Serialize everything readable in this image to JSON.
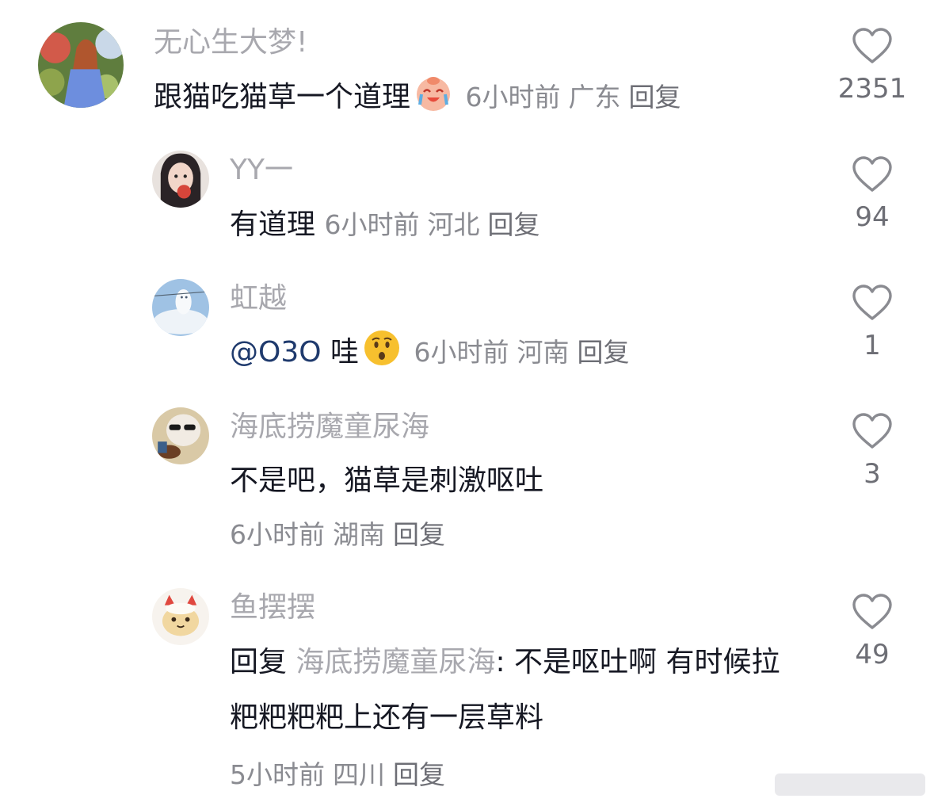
{
  "comments": [
    {
      "username": "无心生大梦!",
      "text": "跟猫吃猫草一个道理",
      "emoji": "crying-laughing-emoji",
      "time": "6小时前",
      "location": "广东",
      "reply": "回复",
      "likes": "2351"
    },
    {
      "username": "YY一",
      "text": "有道理",
      "time": "6小时前",
      "location": "河北",
      "reply": "回复",
      "likes": "94"
    },
    {
      "username": "虹越",
      "mention": "@O3O",
      "text": "哇",
      "emoji": "surprised-face-emoji",
      "time": "6小时前",
      "location": "河南",
      "reply": "回复",
      "likes": "1"
    },
    {
      "username": "海底捞魔童尿海",
      "text": "不是吧，猫草是刺激呕吐",
      "time": "6小时前",
      "location": "湖南",
      "reply": "回复",
      "likes": "3"
    },
    {
      "username": "鱼摆摆",
      "reply_prefix": "回复",
      "reply_to": "海底捞魔童尿海",
      "text": ": 不是呕吐啊  有时候拉粑粑粑粑上还有一层草料",
      "time": "5小时前",
      "location": "四川",
      "reply": "回复",
      "likes": "49"
    }
  ]
}
